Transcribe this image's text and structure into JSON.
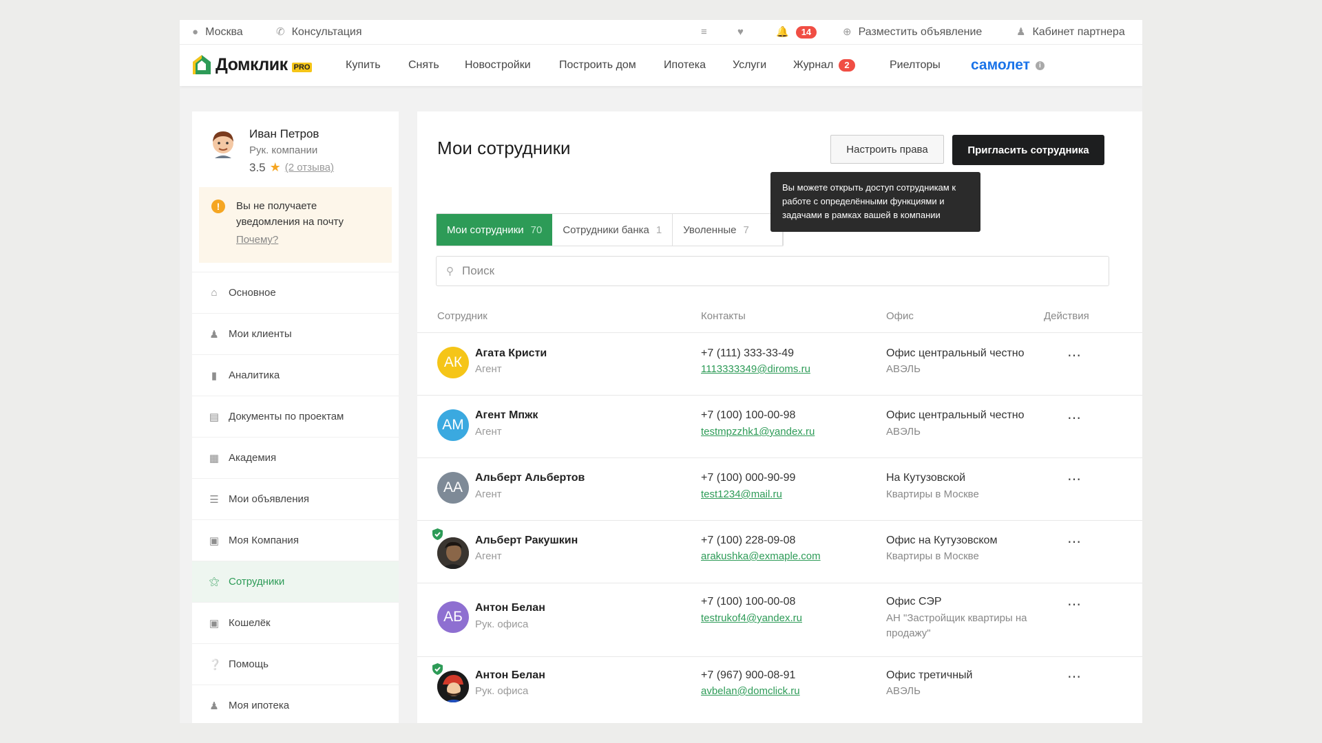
{
  "topbar": {
    "city": "Москва",
    "consult": "Консультация",
    "notif_count": "14",
    "post_ad": "Разместить объявление",
    "partner": "Кабинет партнера"
  },
  "nav": {
    "logo": "Домклик",
    "logo_badge": "PRO",
    "items": [
      "Купить",
      "Снять",
      "Новостройки",
      "Построить дом",
      "Ипотека",
      "Услуги",
      "Журнал",
      "Риелторы"
    ],
    "journal_badge": "2",
    "samolet": "самолет"
  },
  "profile": {
    "name": "Иван Петров",
    "role": "Рук. компании",
    "rating": "3.5",
    "reviews": "(2 отзыва)"
  },
  "warning": {
    "text": "Вы не получаете уведомления на почту",
    "link": "Почему?"
  },
  "menu": [
    "Основное",
    "Мои клиенты",
    "Аналитика",
    "Документы по проектам",
    "Академия",
    "Мои объявления",
    "Моя Компания",
    "Сотрудники",
    "Кошелёк",
    "Помощь",
    "Моя ипотека"
  ],
  "page": {
    "title": "Мои сотрудники",
    "btn_rights": "Настроить права",
    "btn_invite": "Пригласить сотрудника",
    "tooltip": "Вы можете открыть доступ сотрудникам к работе с определёнными функциями и задачами в рамках вашей в компании"
  },
  "tabs": [
    {
      "label": "Мои сотрудники",
      "count": "70"
    },
    {
      "label": "Сотрудники банка",
      "count": "1"
    },
    {
      "label": "Уволенные",
      "count": "7"
    }
  ],
  "search": {
    "placeholder": "Поиск"
  },
  "table": {
    "headers": [
      "Сотрудник",
      "Контакты",
      "Офис",
      "Действия"
    ],
    "rows": [
      {
        "initials": "АК",
        "color": "#f5c518",
        "name": "Агата Кристи",
        "role": "Агент",
        "phone": "+7 (111) 333-33-49",
        "email": "1113333349@diroms.ru",
        "office": "Офис центральный честно",
        "office_sub": "АВЭЛЬ",
        "verified": false
      },
      {
        "initials": "АМ",
        "color": "#3aa9e0",
        "name": "Агент Мпжк",
        "role": "Агент",
        "phone": "+7 (100) 100-00-98",
        "email": "testmpzzhk1@yandex.ru",
        "office": "Офис центральный честно",
        "office_sub": "АВЭЛЬ",
        "verified": false
      },
      {
        "initials": "АА",
        "color": "#7e8a97",
        "name": "Альберт Альбертов",
        "role": "Агент",
        "phone": "+7 (100) 000-90-99",
        "email": "test1234@mail.ru",
        "office": "На Кутузовской",
        "office_sub": "Квартиры в Москве",
        "verified": false
      },
      {
        "initials": "",
        "color": "#5a4a3a",
        "name": "Альберт Ракушкин",
        "role": "Агент",
        "phone": "+7 (100) 228-09-08",
        "email": "arakushka@exmaple.com",
        "office": "Офис на Кутузовском",
        "office_sub": "Квартиры в Москве",
        "verified": true
      },
      {
        "initials": "АБ",
        "color": "#8e6fd1",
        "name": "Антон Белан",
        "role": "Рук. офиса",
        "phone": "+7 (100) 100-00-08",
        "email": "testrukof4@yandex.ru",
        "office": "Офис СЭР",
        "office_sub": "АН \"Застройщик квартиры на продажу\"",
        "verified": false
      },
      {
        "initials": "",
        "color": "#d23a2a",
        "name": "Антон Белан",
        "role": "Рук. офиса",
        "phone": "+7 (967) 900-08-91",
        "email": "avbelan@domclick.ru",
        "office": "Офис третичный",
        "office_sub": "АВЭЛЬ",
        "verified": true
      }
    ]
  }
}
